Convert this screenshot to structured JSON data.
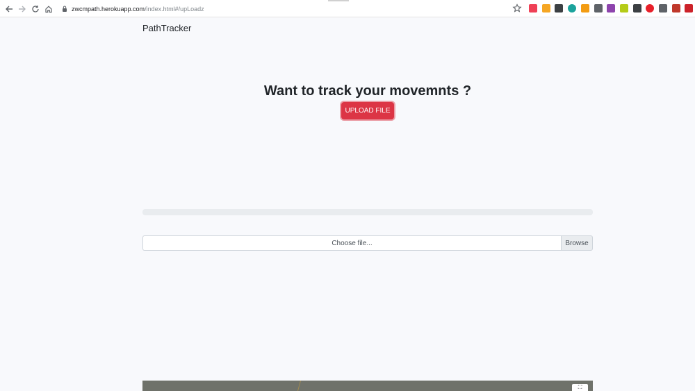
{
  "browser": {
    "url_host": "zwcmpath.herokuapp.com",
    "url_path": "/index.html#/upLoadz",
    "extension_icons": [
      {
        "name": "pocket-icon",
        "color": "#ef4056"
      },
      {
        "name": "coupon-icon",
        "color": "#f5a623"
      },
      {
        "name": "shield-dark-icon",
        "color": "#3c4043"
      },
      {
        "name": "teal-circle-icon",
        "color": "#1ba39c"
      },
      {
        "name": "grid-orange-icon",
        "color": "#f39c12"
      },
      {
        "name": "mic-icon",
        "color": "#5f6368"
      },
      {
        "name": "purple-ext-icon",
        "color": "#8e44ad"
      },
      {
        "name": "green-ext-icon",
        "color": "#b5cc18"
      },
      {
        "name": "pin-icon",
        "color": "#3c4043"
      },
      {
        "name": "adblock-icon",
        "color": "#e8202a"
      },
      {
        "name": "camera-icon",
        "color": "#5f6368"
      },
      {
        "name": "pinwheel-icon",
        "color": "#c0392b"
      },
      {
        "name": "lastpass-icon",
        "color": "#cc2229"
      }
    ]
  },
  "nav": {
    "brand": "PathTracker"
  },
  "main": {
    "headline": "Want to track your movemnts ?",
    "upload_button": "UPLOAD FILE",
    "progress_fraction": 0,
    "file_input": {
      "placeholder": "Choose file...",
      "browse": "Browse"
    }
  },
  "map": {
    "fullscreen_label": "⛶"
  },
  "colors": {
    "accent_red": "#dc3545",
    "page_bg": "#f8f9fc"
  }
}
